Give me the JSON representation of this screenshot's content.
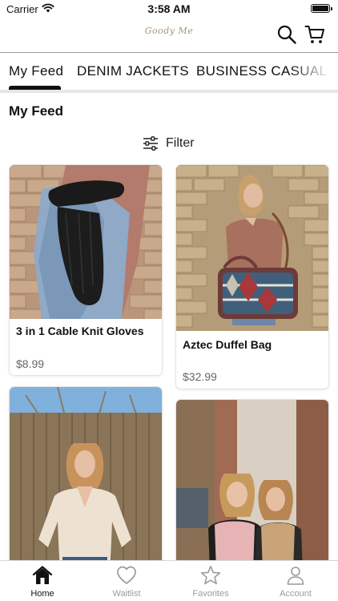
{
  "status_bar": {
    "carrier": "Carrier",
    "time": "3:58 AM"
  },
  "header": {
    "logo_text": "Goody Me",
    "icons": [
      "search-icon",
      "cart-icon"
    ]
  },
  "tabs": [
    {
      "label": "My Feed",
      "active": true
    },
    {
      "label": "DENIM JACKETS",
      "active": false
    },
    {
      "label": "BUSINESS CASUAL",
      "active": false
    }
  ],
  "feed": {
    "title": "My Feed",
    "filter_label": "Filter"
  },
  "products": [
    {
      "name": "3 in 1 Cable Knit Gloves",
      "price": "$8.99"
    },
    {
      "name": "Aztec Duffel Bag",
      "price": "$32.99"
    },
    {
      "name": "",
      "price": ""
    },
    {
      "name": "",
      "price": ""
    }
  ],
  "tabbar": [
    {
      "label": "Home",
      "icon": "home-icon",
      "active": true
    },
    {
      "label": "Waitlist",
      "icon": "heart-icon",
      "active": false
    },
    {
      "label": "Favorites",
      "icon": "star-icon",
      "active": false
    },
    {
      "label": "Account",
      "icon": "person-icon",
      "active": false
    }
  ],
  "colors": {
    "accent": "#111111",
    "inactive": "#9a9a9a",
    "logo": "#a89478"
  }
}
